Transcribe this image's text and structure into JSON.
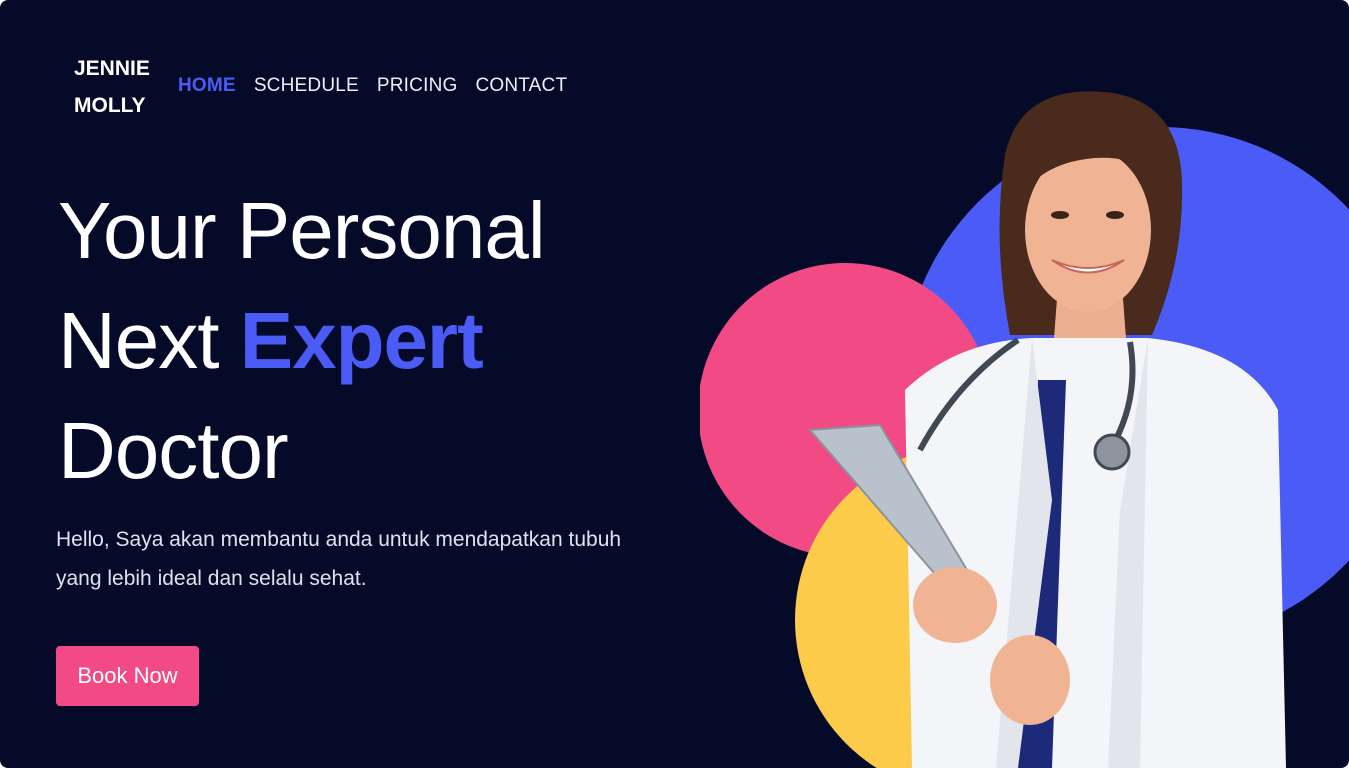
{
  "brand": {
    "line1": "JENNIE",
    "line2": "MOLLY"
  },
  "nav": {
    "items": [
      {
        "label": "HOME",
        "active": true
      },
      {
        "label": "SCHEDULE",
        "active": false
      },
      {
        "label": "PRICING",
        "active": false
      },
      {
        "label": "CONTACT",
        "active": false
      }
    ]
  },
  "hero": {
    "headline_line1": "Your Personal",
    "headline_line2_start": "Next ",
    "headline_accent": "Expert",
    "headline_line3": "Doctor",
    "description": "Hello, Saya akan membantu anda untuk mendapatkan tubuh yang lebih ideal dan selalu sehat.",
    "cta_label": "Book Now"
  },
  "colors": {
    "background": "#050a29",
    "accent_blue": "#4a5cf5",
    "accent_pink": "#f24a85",
    "accent_yellow": "#fdcb4a",
    "text_light": "#ffffff"
  },
  "hero_image": {
    "subject": "doctor-in-white-coat-with-clipboard-and-stethoscope"
  }
}
